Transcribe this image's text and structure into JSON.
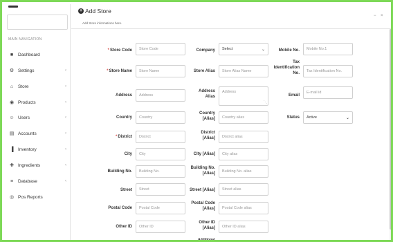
{
  "sidebar": {
    "nav_title": "MAIN NAVIGATION",
    "items": [
      {
        "label": "Dashboard",
        "icon": "dashboard-icon",
        "glyph": "■",
        "chevron": ""
      },
      {
        "label": "Settings",
        "icon": "gear-icon",
        "glyph": "⚙",
        "chevron": "‹"
      },
      {
        "label": "Store",
        "icon": "store-icon",
        "glyph": "⌂",
        "chevron": "‹"
      },
      {
        "label": "Products",
        "icon": "products-icon",
        "glyph": "◉",
        "chevron": "‹"
      },
      {
        "label": "Users",
        "icon": "users-icon",
        "glyph": "☺",
        "chevron": "‹"
      },
      {
        "label": "Accounts",
        "icon": "accounts-icon",
        "glyph": "▤",
        "chevron": "‹"
      },
      {
        "label": "Inventory",
        "icon": "inventory-icon",
        "glyph": "▐",
        "chevron": "‹"
      },
      {
        "label": "Ingredients",
        "icon": "ingredients-icon",
        "glyph": "✚",
        "chevron": "‹"
      },
      {
        "label": "Database",
        "icon": "database-icon",
        "glyph": "≡",
        "chevron": "‹"
      },
      {
        "label": "Pos Reports",
        "icon": "reports-icon",
        "glyph": "◎",
        "chevron": "‹"
      }
    ]
  },
  "header": {
    "title": "Add Store",
    "subtitle": "Add Store informations here.",
    "minimize": "−",
    "close": "×"
  },
  "form": {
    "store_code": {
      "label": "Store Code",
      "placeholder": "Store Code"
    },
    "store_name": {
      "label": "Store Name",
      "placeholder": "Store Name"
    },
    "address": {
      "label": "Address",
      "placeholder": "Address"
    },
    "country": {
      "label": "Country",
      "placeholder": "Country"
    },
    "district": {
      "label": "District",
      "placeholder": "District"
    },
    "city": {
      "label": "City",
      "placeholder": "City"
    },
    "building_no": {
      "label": "Building No.",
      "placeholder": "Building No."
    },
    "street": {
      "label": "Street",
      "placeholder": "Street"
    },
    "postal_code": {
      "label": "Postal Code",
      "placeholder": "Postal Code"
    },
    "other_id": {
      "label": "Other ID",
      "placeholder": "Other ID"
    },
    "company": {
      "label": "Company",
      "value": "Select"
    },
    "store_alias": {
      "label": "Store Alias",
      "placeholder": "Store Alias Name"
    },
    "address_alias": {
      "label1": "Address",
      "label2": "Alias",
      "placeholder": "Address"
    },
    "country_alias": {
      "label1": "Country",
      "label2": "[Alias]",
      "placeholder": "Country alias"
    },
    "district_alias": {
      "label1": "District",
      "label2": "[Alias]",
      "placeholder": "District alias"
    },
    "city_alias": {
      "label": "City [Alias]",
      "placeholder": "City alias"
    },
    "building_alias": {
      "label1": "Building No.",
      "label2": "[Alias]",
      "placeholder": "Building No. alias"
    },
    "street_alias": {
      "label": "Street [Alias]",
      "placeholder": "Street alias"
    },
    "postal_alias": {
      "label1": "Postal Code",
      "label2": "[Alias]",
      "placeholder": "Postal Code alias"
    },
    "other_alias": {
      "label1": "Other ID",
      "label2": "[Alias]",
      "placeholder": "Other ID alias"
    },
    "cut_label": "Additional",
    "mobile": {
      "label": "Mobile No.",
      "placeholder": "Mobile No.1"
    },
    "tax": {
      "label1": "Tax",
      "label2": "Identification",
      "label3": "No.",
      "placeholder": "Tax Identification No."
    },
    "email": {
      "label": "Email",
      "placeholder": "E-mail id"
    },
    "status": {
      "label": "Status",
      "value": "Active"
    }
  },
  "colors": {
    "frame": "#7ed957",
    "required": "#d9534f"
  }
}
